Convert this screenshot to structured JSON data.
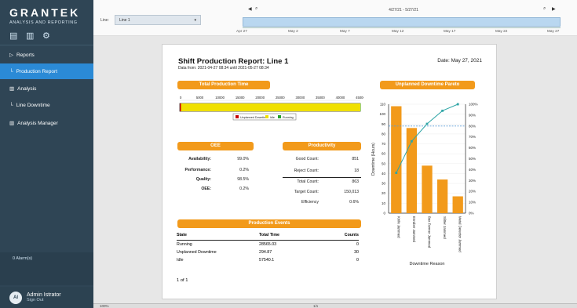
{
  "brand": {
    "name": "GRANTEK",
    "subtitle": "ANALYSIS AND REPORTING"
  },
  "sidebar": {
    "tools": [
      "chart-report-icon",
      "analysis-icon",
      "settings-icon"
    ],
    "items": [
      {
        "label": "Reports",
        "icon": "reports-triangle-icon"
      },
      {
        "label": "Production Report",
        "icon": "sub-branch-icon"
      },
      {
        "label": "Analysis",
        "icon": "analysis-icon"
      },
      {
        "label": "Line Downtime",
        "icon": "sub-branch-icon"
      },
      {
        "label": "Analysis Manager",
        "icon": "analysis-manager-icon"
      }
    ],
    "alarms": "0 Alarm(s)",
    "user": {
      "initials": "AI",
      "name": "Admin Istrator",
      "signout": "Sign Out"
    }
  },
  "topbar": {
    "line_label": "Line:",
    "line_value": "Line 1",
    "range_text": "4/27/21 - 5/27/21",
    "dates": [
      "Apr 27",
      "May 2",
      "May 7",
      "May 12",
      "May 17",
      "May 22",
      "May 27"
    ]
  },
  "report": {
    "title": "Shift Production Report: Line 1",
    "subtitle": "Data from: 2021-04-27 08:34   until  2021-05-27 08:34",
    "date": "Date: May 27, 2021",
    "page_count": "1 of 1",
    "total_production": {
      "title": "Total Production Time",
      "axis": [
        "0",
        "5000",
        "10000",
        "15000",
        "20000",
        "25000",
        "30000",
        "35000",
        "40000",
        "45000"
      ],
      "legend": [
        "Unplanned Downtime",
        "Idle",
        "Running"
      ],
      "values_seconds": {
        "Unplanned Downtime": 294.87,
        "Idle": 57540.1,
        "Running": 28565.03
      }
    },
    "oee": {
      "title": "OEE",
      "rows": [
        {
          "label": "Availability:",
          "value": "99.0%"
        },
        {
          "label": "Performance:",
          "value": "0.2%"
        },
        {
          "label": "Quality:",
          "value": "98.5%"
        },
        {
          "label": "OEE:",
          "value": "0.2%"
        }
      ]
    },
    "productivity": {
      "title": "Productivity",
      "rows": [
        {
          "label": "Good Count:",
          "value": "851"
        },
        {
          "label": "Reject Count:",
          "value": "18"
        },
        {
          "label": "Total Count:",
          "value": "863"
        },
        {
          "label": "Target Count:",
          "value": "150,013"
        },
        {
          "label": "Efficiency",
          "value": "0.6%"
        }
      ]
    },
    "events": {
      "title": "Production Events",
      "headers": [
        "State",
        "Total Time",
        "Counts"
      ],
      "rows": [
        [
          "Running",
          "28565.03",
          "0"
        ],
        [
          "Unplanned Downtime",
          "294.87",
          "30"
        ],
        [
          "Idle",
          "57540.1",
          "0"
        ]
      ]
    }
  },
  "bottombar": {
    "zoom": "100%",
    "page": "1/1"
  },
  "chart_data": [
    {
      "type": "bar",
      "title": "Total Production Time",
      "orientation": "horizontal-stacked",
      "categories": [
        "Total"
      ],
      "series": [
        {
          "name": "Unplanned Downtime",
          "values": [
            294.87
          ]
        },
        {
          "name": "Idle",
          "values": [
            57540.1
          ]
        },
        {
          "name": "Running",
          "values": [
            28565.03
          ]
        }
      ],
      "xlim": [
        0,
        45000
      ],
      "xticks": [
        0,
        5000,
        10000,
        15000,
        20000,
        25000,
        30000,
        35000,
        40000,
        45000
      ],
      "colors": [
        "#c60000",
        "#f0e000",
        "#24a12c"
      ]
    },
    {
      "type": "bar",
      "title": "Unplanned Downtime Pareto",
      "categories": [
        "Knife Jammed",
        "Enrober Jammed",
        "Box Former Jammed",
        "Slitter Jammed",
        "Metal Detector Jammed"
      ],
      "values": [
        108,
        86,
        48,
        34,
        17
      ],
      "cumulative_percent": [
        37,
        66,
        82,
        94,
        100
      ],
      "xlabel": "Downtime Reason",
      "ylabel": "Downtime (Hours)",
      "ylim": [
        0,
        110
      ],
      "yticks": [
        0,
        10,
        20,
        30,
        40,
        50,
        60,
        70,
        80,
        90,
        100,
        110
      ],
      "y2ticks": [
        "0%",
        "10%",
        "20%",
        "30%",
        "40%",
        "50%",
        "60%",
        "70%",
        "80%",
        "90%",
        "100%"
      ],
      "threshold": "80%",
      "colors": {
        "bar": "#f29a1b",
        "line": "#2fa5a6",
        "threshold": "#5b9bd5"
      }
    }
  ]
}
